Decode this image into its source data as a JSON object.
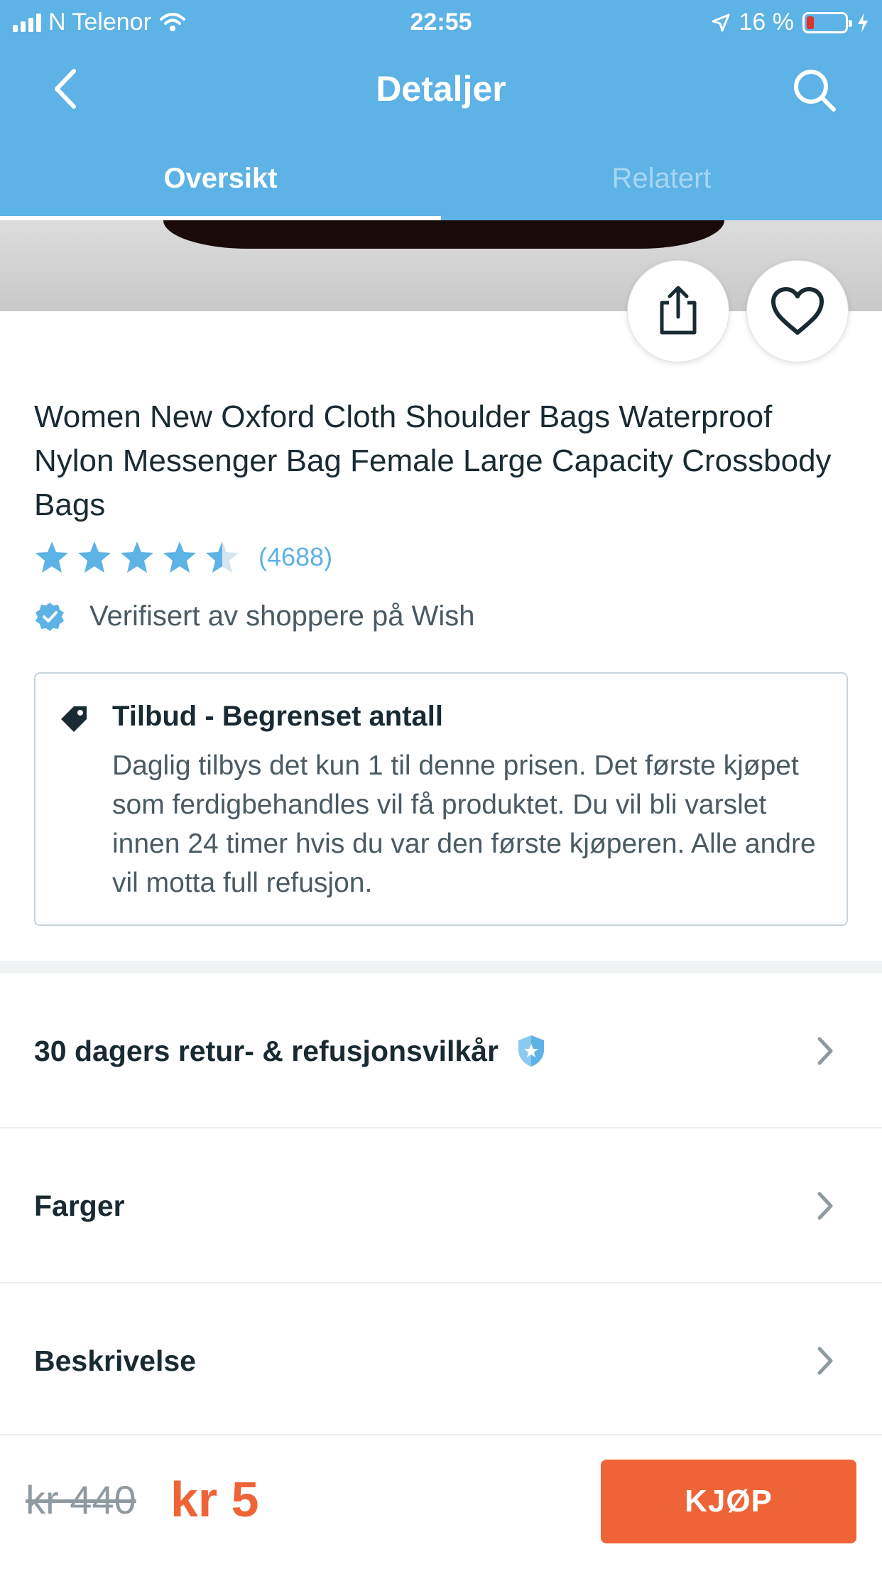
{
  "status_bar": {
    "carrier": "N Telenor",
    "time": "22:55",
    "battery": "16 %",
    "battery_level": 0.16
  },
  "nav": {
    "title": "Detaljer",
    "back_icon": "chevron-left-icon",
    "search_icon": "search-icon"
  },
  "tabs": [
    {
      "label": "Oversikt",
      "active": true
    },
    {
      "label": "Relatert",
      "active": false
    }
  ],
  "product": {
    "title": "Women New Oxford Cloth Shoulder Bags Waterproof Nylon Messenger Bag Female Large Capacity Crossbody Bags",
    "rating": 4.5,
    "rating_count": "(4688)",
    "verified_text": "Verifisert av shoppere på Wish"
  },
  "offer": {
    "title": "Tilbud - Begrenset antall",
    "body": "Daglig tilbys det kun 1 til denne prisen. Det første kjøpet som ferdigbehandles vil få produktet. Du vil bli varslet innen 24 timer hvis du var den første kjøperen. Alle andre vil motta full refusjon."
  },
  "rows": [
    {
      "label": "30 dagers retur- & refusjonsvilkår"
    },
    {
      "label": "Farger"
    },
    {
      "label": "Beskrivelse"
    }
  ],
  "bottom": {
    "old_price": "kr 440",
    "new_price": "kr 5",
    "buy_label": "KJØP"
  },
  "colors": {
    "brand_blue": "#5db2e6",
    "accent_orange": "#ee6436",
    "text_dark": "#192a32"
  }
}
